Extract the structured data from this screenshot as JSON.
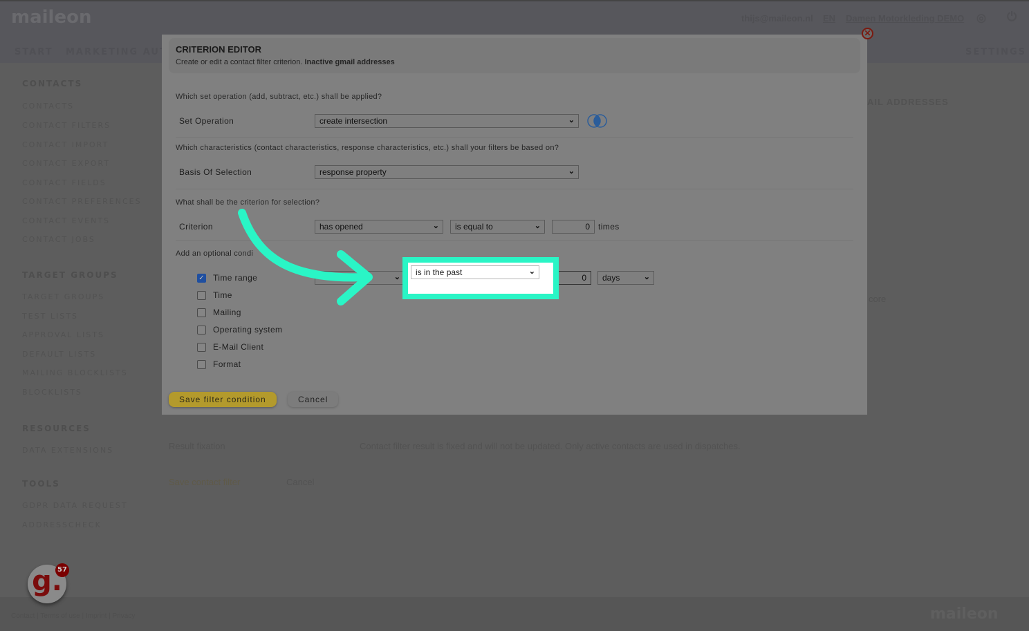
{
  "header": {
    "logo": "maileon",
    "user": "thijs@maileon.nl",
    "lang": "EN",
    "account": "Damen Motorkleding DEMO",
    "nav": [
      "START",
      "MARKETING AUTO"
    ],
    "settings": "SETTINGS"
  },
  "sidebar": {
    "sections": [
      {
        "title": "CONTACTS",
        "items": [
          "CONTACTS",
          "CONTACT FILTERS",
          "CONTACT IMPORT",
          "CONTACT EXPORT",
          "CONTACT FIELDS",
          "CONTACT PREFERENCES",
          "CONTACT EVENTS",
          "CONTACT JOBS"
        ]
      },
      {
        "title": "TARGET GROUPS",
        "items": [
          "TARGET GROUPS",
          "TEST LISTS",
          "APPROVAL LISTS",
          "DEFAULT LISTS",
          "MAILING BLOCKLISTS",
          "BLOCKLISTS"
        ]
      },
      {
        "title": "RESOURCES",
        "items": [
          "DATA EXTENSIONS"
        ]
      },
      {
        "title": "TOOLS",
        "items": [
          "GDPR DATA REQUEST",
          "ADDRESSCHECK"
        ]
      }
    ]
  },
  "background": {
    "title_fragment": "AIL ADDRESSES",
    "score_label": "core",
    "result_fixation": "Result fixation",
    "fixation_text": "Contact filter result is fixed and will not be updated. Only active contacts are used in dispatches.",
    "save": "Save contact filter",
    "cancel": "Cancel"
  },
  "modal": {
    "title": "CRITERION EDITOR",
    "subtitle": "Create or edit a contact filter criterion.",
    "filter_name": "Inactive gmail addresses",
    "q1": "Which set operation (add, subtract, etc.) shall be applied?",
    "set_operation_label": "Set Operation",
    "set_operation_value": "create intersection",
    "q2": "Which characteristics (contact characteristics, response characteristics, etc.) shall your filters be based on?",
    "basis_label": "Basis Of Selection",
    "basis_value": "response property",
    "q3": "What shall be the criterion for selection?",
    "criterion_label": "Criterion",
    "criterion_value": "has opened",
    "comparator_value": "is equal to",
    "count_value": "0",
    "times": "times",
    "q4": "Add an optional condi",
    "conditions": [
      {
        "label": "Time range",
        "checked": true
      },
      {
        "label": "Time",
        "checked": false
      },
      {
        "label": "Mailing",
        "checked": false
      },
      {
        "label": "Operating system",
        "checked": false
      },
      {
        "label": "E-Mail Client",
        "checked": false
      },
      {
        "label": "Format",
        "checked": false
      }
    ],
    "time_range_op": "is in the past",
    "time_range_value": "0",
    "time_range_unit": "days",
    "save": "Save filter condition",
    "cancel": "Cancel"
  },
  "footer": {
    "links": "Contact | Terms of use | Imprint | Privacy",
    "brand": "maileon"
  },
  "badge": {
    "count": "57",
    "letter": "g."
  },
  "colors": {
    "highlight": "#2af5c6",
    "save_button": "#b39a2c",
    "close": "#7a1a10"
  }
}
